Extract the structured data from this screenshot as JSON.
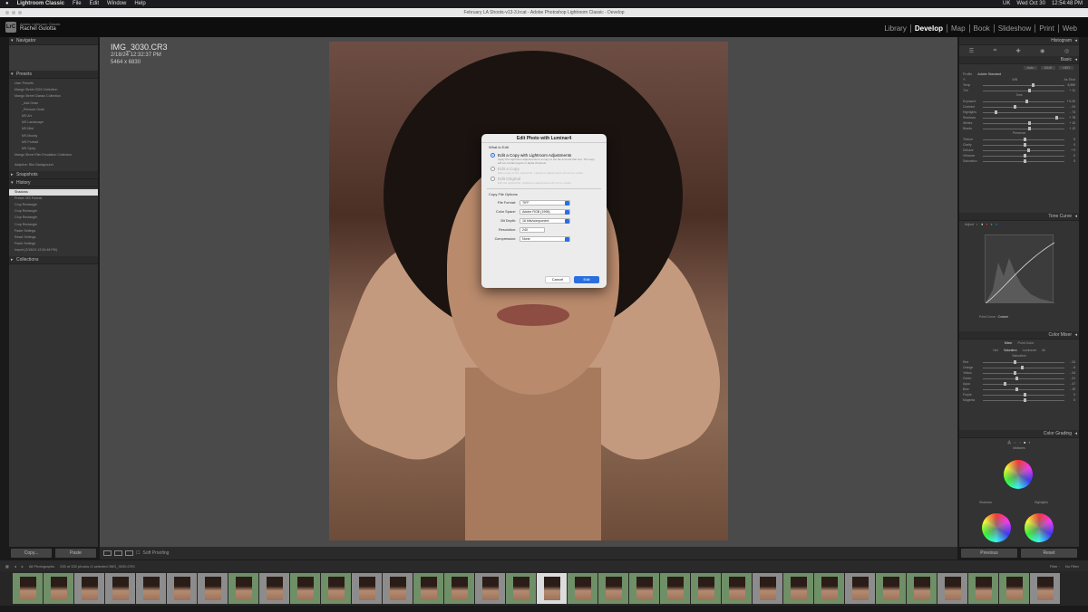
{
  "menubar": {
    "apple": "",
    "app": "Lightroom Classic",
    "items": [
      "File",
      "Edit",
      "Window",
      "Help"
    ],
    "status": [
      "UK",
      "Wed Oct 30",
      "12:54:48 PM"
    ]
  },
  "window_title": "February LA Shoots-v13-3.lrcat - Adobe Photoshop Lightroom Classic - Develop",
  "identity": {
    "logo": "LrC",
    "app": "Adobe Lightroom Classic",
    "user": "Rachel Gulotta"
  },
  "modules": [
    "Library",
    "Develop",
    "Map",
    "Book",
    "Slideshow",
    "Print",
    "Web"
  ],
  "active_module": "Develop",
  "left": {
    "navigator": "Navigator",
    "presets": "Presets",
    "preset_items": [
      "User Presets",
      "Mango Street 2024 Collection",
      "Mango Street Classic Collection",
      "_Add Grain",
      "_Remove Grain",
      "MS Art",
      "MS Landscape",
      "MS Mist",
      "MS Moody",
      "MS Portrait",
      "MS Spicy",
      "Mango Street Film Emulation Collection",
      "Adaptive: Blur Background"
    ],
    "snapshots": "Snapshots",
    "history": "History",
    "history_items": [
      "Shadows",
      "Preset: MS Portrait",
      "Crop Rectangle",
      "Crop Rectangle",
      "Crop Rectangle",
      "Crop Rectangle",
      "Paste Settings",
      "Reset Settings",
      "Paste Settings",
      "Import (2/18/24 12:54:48 PM)"
    ],
    "collections": "Collections",
    "copy": "Copy...",
    "paste": "Paste"
  },
  "image": {
    "name": "IMG_3030.CR3",
    "date": "2/18/24 12:32:37 PM",
    "size": "5464 x 6830"
  },
  "toolbar": {
    "soft_proofing": "Soft Proofing"
  },
  "dialog": {
    "title": "Edit Photo with Luminar4",
    "what": "What to Edit",
    "opt1": "Edit a Copy with Lightroom Adjustments",
    "opt1_desc": "Apply the Lightroom adjustments to a copy of the file and edit that one. The copy will not contain layers or alpha channels.",
    "opt2": "Edit a Copy",
    "opt2_desc": "Edit a copy of the original file. Lightroom adjustments will not be visible.",
    "opt3": "Edit Original",
    "opt3_desc": "Edit the original file. Lightroom adjustments will not be visible.",
    "copy_opts": "Copy File Options",
    "file_format_label": "File Format:",
    "file_format": "TIFF",
    "color_space_label": "Color Space:",
    "color_space": "Adobe RGB (1998)",
    "bit_depth_label": "Bit Depth:",
    "bit_depth": "16 bits/component",
    "resolution_label": "Resolution:",
    "resolution": "240",
    "compression_label": "Compression:",
    "compression": "None",
    "cancel": "Cancel",
    "edit": "Edit"
  },
  "right": {
    "histogram": "Histogram",
    "basic": "Basic",
    "modes": [
      "Auto",
      "B&W",
      "HDR"
    ],
    "profile_label": "Profile",
    "profile": "Adobe Standard",
    "wb": "WB",
    "wb_value": "As Shot",
    "basic_sliders": [
      {
        "label": "Temp",
        "value": "5,950"
      },
      {
        "label": "Tint",
        "value": "+ 11"
      },
      {
        "label": "Exposure",
        "value": "+ 0.20"
      },
      {
        "label": "Contrast",
        "value": "- 24"
      },
      {
        "label": "Highlights",
        "value": "- 73"
      },
      {
        "label": "Shadows",
        "value": "+ 78"
      },
      {
        "label": "Whites",
        "value": "+ 10"
      },
      {
        "label": "Blacks",
        "value": "+ 12"
      }
    ],
    "presence": "Presence",
    "presence_sliders": [
      {
        "label": "Texture",
        "value": "0"
      },
      {
        "label": "Clarity",
        "value": "0"
      },
      {
        "label": "Dehaze",
        "value": "+ 9"
      },
      {
        "label": "Vibrance",
        "value": "0"
      },
      {
        "label": "Saturation",
        "value": "0"
      }
    ],
    "tone_curve": "Tone Curve",
    "adjust": "Adjust",
    "point_curve": "Point Curve :",
    "point_curve_value": "Custom",
    "color_mixer": "Color Mixer",
    "mixer_modes": [
      "Mixer",
      "Point Color"
    ],
    "mixer_tabs": [
      "Hue",
      "Saturation",
      "Luminance",
      "All"
    ],
    "saturation": "Saturation",
    "mixer_sliders": [
      {
        "label": "Red",
        "value": "- 24"
      },
      {
        "label": "Orange",
        "value": "- 6"
      },
      {
        "label": "Yellow",
        "value": "- 24"
      },
      {
        "label": "Green",
        "value": "- 21"
      },
      {
        "label": "Aqua",
        "value": "- 47"
      },
      {
        "label": "Blue",
        "value": "- 19"
      },
      {
        "label": "Purple",
        "value": "0"
      },
      {
        "label": "Magenta",
        "value": "0"
      }
    ],
    "color_grading": "Color Grading",
    "midtones": "Midtones",
    "shadows": "Shadows",
    "highlights": "Highlights",
    "previous": "Previous",
    "reset": "Reset"
  },
  "filmstrip": {
    "source": "All Photographs",
    "count": "235 of 332 photos /1 selected /IMG_3030.CR3",
    "filter_label": "Filter :",
    "filter": "No Filter"
  }
}
